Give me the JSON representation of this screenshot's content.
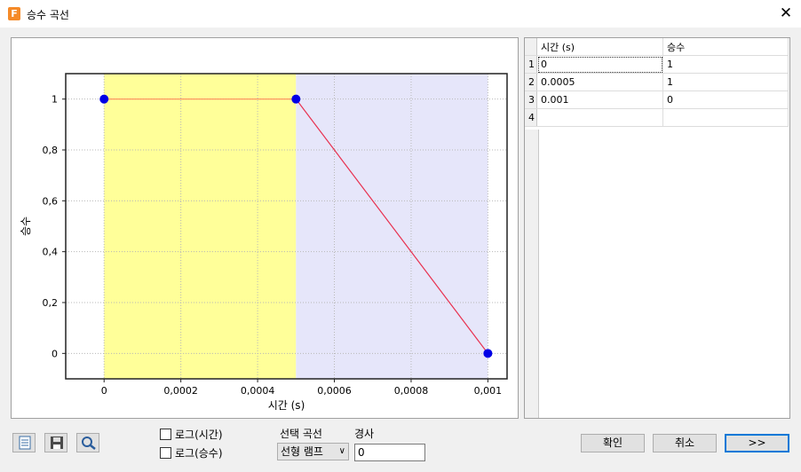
{
  "window": {
    "title": "승수 곡선",
    "close_symbol": "✕",
    "app_icon_letter": "F"
  },
  "chart_data": {
    "type": "line",
    "xlabel": "시간 (s)",
    "ylabel": "승수",
    "x": [
      0,
      0.0005,
      0.001
    ],
    "y": [
      1,
      1,
      0
    ],
    "xlim": [
      -0.0001,
      0.00105
    ],
    "ylim": [
      -0.1,
      1.1
    ],
    "x_ticks": [
      0,
      0.0002,
      0.0004,
      0.0006,
      0.0008,
      0.001
    ],
    "x_tick_labels": [
      "0",
      "0,0002",
      "0,0004",
      "0,0006",
      "0,0008",
      "0,001"
    ],
    "y_ticks": [
      0,
      0.2,
      0.4,
      0.6,
      0.8,
      1
    ],
    "y_tick_labels": [
      "0",
      "0,2",
      "0,4",
      "0,6",
      "0,8",
      "1"
    ],
    "grid": true,
    "colors": {
      "segment1": "#ff8c5a",
      "segment2": "#e8304f",
      "points": "#0000e6",
      "band1": "#ffff99",
      "band2": "#e6e6fa",
      "plot_bg": "#ffffff"
    }
  },
  "table": {
    "headers": [
      "시간 (s)",
      "승수"
    ],
    "rows": [
      {
        "num": "1",
        "time": "0",
        "mult": "1"
      },
      {
        "num": "2",
        "time": "0.0005",
        "mult": "1"
      },
      {
        "num": "3",
        "time": "0.001",
        "mult": "0"
      },
      {
        "num": "4",
        "time": "",
        "mult": ""
      }
    ]
  },
  "options": {
    "log_time_label": "로그(시간)",
    "log_mult_label": "로그(승수)",
    "log_time_checked": false,
    "log_mult_checked": false,
    "select_curve_label": "선택 곡선",
    "select_curve_value": "선형 램프",
    "slope_label": "경사",
    "slope_value": "0"
  },
  "buttons": {
    "ok": "확인",
    "cancel": "취소",
    "more": ">>"
  },
  "icons": {
    "export": "table-export-icon",
    "save": "save-icon",
    "zoom": "magnifier-icon"
  }
}
